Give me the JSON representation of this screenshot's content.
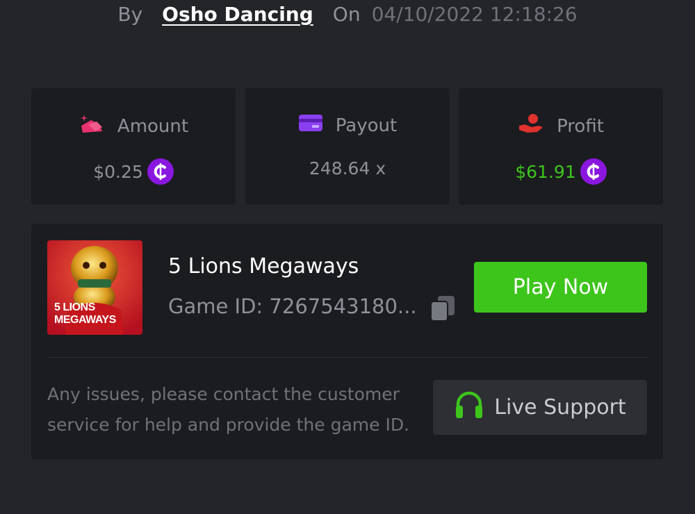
{
  "bet_meta": {
    "by_label": "By",
    "username": "Osho Dancing",
    "on_label": "On",
    "datetime": "04/10/2022 12:18:26"
  },
  "stats": {
    "amount": {
      "label": "Amount",
      "value": "$0.25",
      "icon": "bet-amount-icon"
    },
    "payout": {
      "label": "Payout",
      "value": "248.64 x",
      "icon": "card-icon"
    },
    "profit": {
      "label": "Profit",
      "value": "$61.91",
      "icon": "hand-coin-icon"
    }
  },
  "game": {
    "name": "5 Lions Megaways",
    "id_text": "Game ID: 7267543180...",
    "thumb_line1": "5 LIONS",
    "thumb_line2": "MEGAWAYS",
    "play_label": "Play Now"
  },
  "support": {
    "help_text": "Any issues, please contact the customer service for help and provide the game ID.",
    "button_label": "Live Support"
  },
  "colors": {
    "background": "#232529",
    "card": "#1b1c20",
    "accent_green": "#3ec51c",
    "coin_purple": "#8a17e0",
    "amount_pink": "#e8336f",
    "payout_purple": "#8a3ff0",
    "profit_red": "#e0322f"
  }
}
